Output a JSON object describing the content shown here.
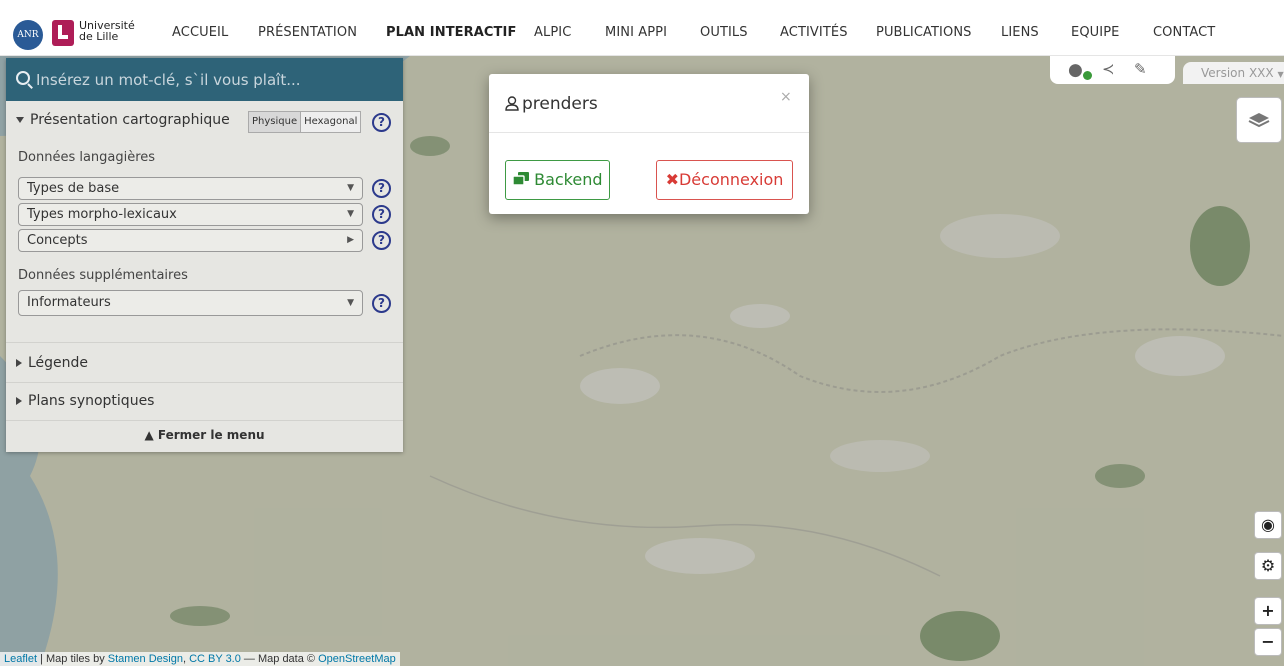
{
  "header": {
    "anr_logo_text": "ANR",
    "university_name": "Université\nde Lille",
    "nav": [
      {
        "label": "ACCUEIL",
        "active": false
      },
      {
        "label": "PRÉSENTATION",
        "active": false
      },
      {
        "label": "PLAN INTERACTIF",
        "active": true
      },
      {
        "label": "ALPIC",
        "active": false
      },
      {
        "label": "MINI APPI",
        "active": false
      },
      {
        "label": "OUTILS",
        "active": false
      },
      {
        "label": "ACTIVITÉS",
        "active": false
      },
      {
        "label": "PUBLICATIONS",
        "active": false
      },
      {
        "label": "LIENS",
        "active": false
      },
      {
        "label": "EQUIPE",
        "active": false
      },
      {
        "label": "CONTACT",
        "active": false
      }
    ]
  },
  "sidebar": {
    "search_placeholder": "Insérez un mot-clé, s`il vous plaît...",
    "carto_title": "Présentation cartographique",
    "view_toggle": [
      "Physique",
      "Hexagonal"
    ],
    "lang_data_label": "Données langagières",
    "lang_selects": [
      "Types de base",
      "Types morpho-lexicaux",
      "Concepts"
    ],
    "extra_data_label": "Données supplémentaires",
    "extra_select": "Informateurs",
    "legend_label": "Légende",
    "synoptic_label": "Plans synoptiques",
    "close_menu": "Fermer le menu",
    "help_glyph": "?"
  },
  "version_label": "Version XXX",
  "map_controls": {
    "zoom_in": "+",
    "zoom_out": "−"
  },
  "attribution": {
    "leaflet": "Leaflet",
    "sep1": " | Map tiles by ",
    "stamen": "Stamen Design",
    "sep2": ", ",
    "cc": "CC BY 3.0",
    "sep3": " — Map data © ",
    "osm": "OpenStreetMap"
  },
  "modal": {
    "username": "prenders",
    "close": "×",
    "backend_label": "Backend",
    "logout_label": "Déconnexion"
  },
  "colors": {
    "search_bar": "#2e6378",
    "help_icon": "#2c3a8c",
    "backend": "#2e8a34",
    "logout": "#d83b36",
    "brand": "#ae1d57"
  }
}
